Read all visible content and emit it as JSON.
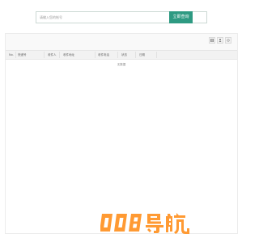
{
  "search": {
    "placeholder": "请输入您的帐号",
    "button_label": "立即查询"
  },
  "toolbar": {
    "icons": [
      "columns-icon",
      "export-icon",
      "refresh-icon"
    ]
  },
  "table": {
    "columns": [
      "No.",
      "快递号",
      "收件人",
      "收件地址",
      "收件电话",
      "状态",
      "日期"
    ],
    "empty_text": "无数据"
  },
  "logo": {
    "text": "008导航",
    "color": "#ff9a33"
  }
}
